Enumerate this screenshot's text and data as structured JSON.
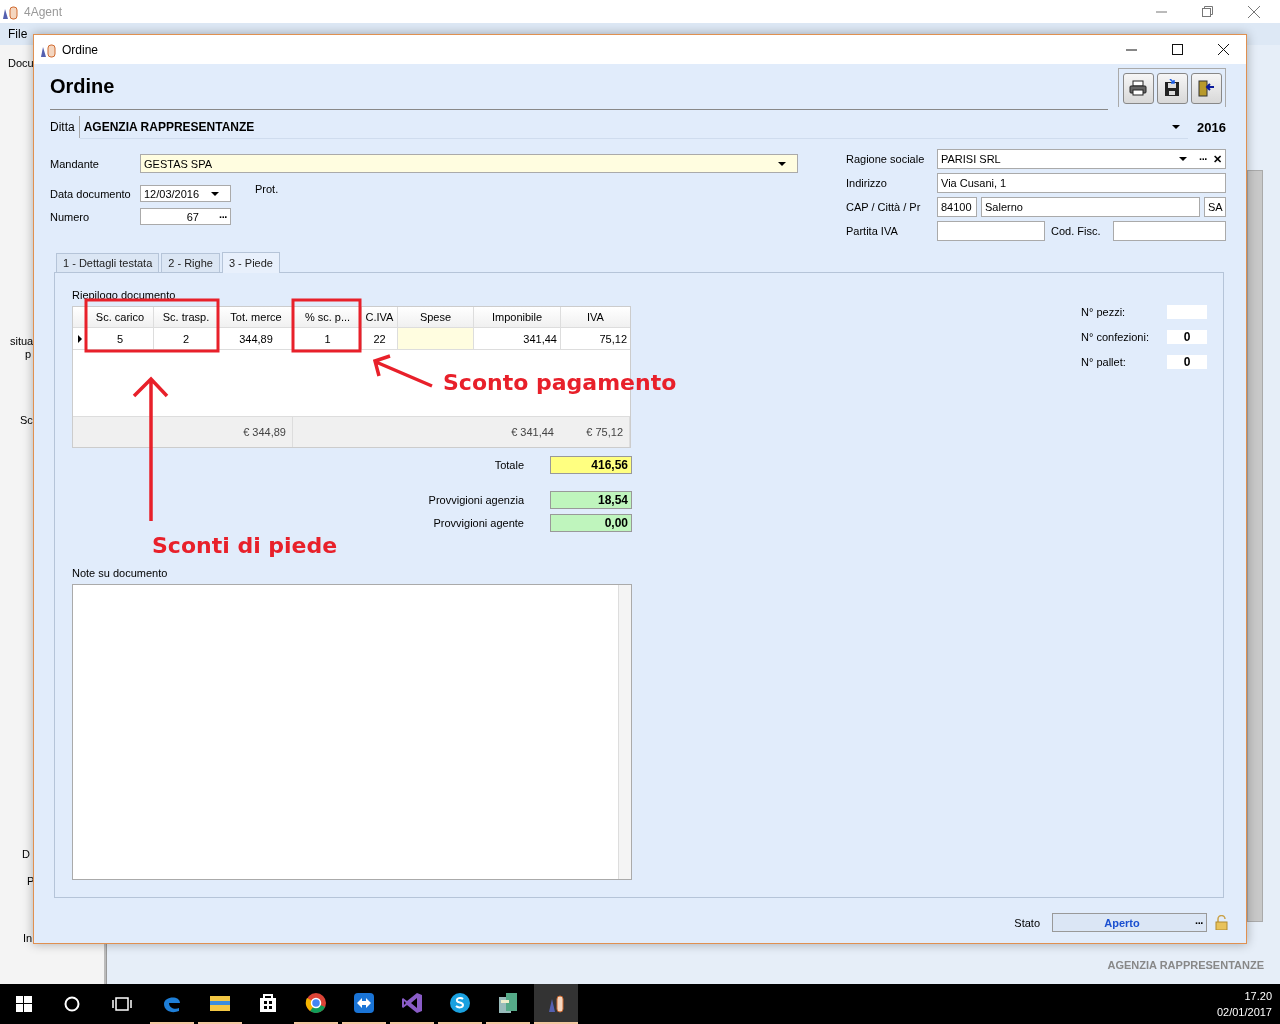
{
  "app": {
    "title": "4Agent",
    "menu": [
      "File"
    ],
    "side_fragments": [
      "Docu",
      "situa",
      "p",
      "Sc",
      "D",
      "P",
      "In"
    ],
    "footer": "AGENZIA RAPPRESENTANZE"
  },
  "dialog": {
    "title": "Ordine",
    "heading": "Ordine",
    "toolbar": [
      {
        "kind": "print"
      },
      {
        "kind": "save"
      },
      {
        "kind": "exit"
      }
    ],
    "ditta": {
      "label": "Ditta",
      "value": "AGENZIA RAPPRESENTANZE",
      "year": "2016"
    },
    "mandante": {
      "label": "Mandante",
      "value": "GESTAS SPA"
    },
    "data_documento": {
      "label": "Data documento",
      "value": "12/03/2016"
    },
    "numero": {
      "label": "Numero",
      "value": "67",
      "more": "···"
    },
    "prot": {
      "label": "Prot."
    },
    "ragione_sociale": {
      "label": "Ragione sociale",
      "value": "PARISI SRL",
      "more": "···",
      "clear": "✕"
    },
    "indirizzo": {
      "label": "Indirizzo",
      "value": "Via Cusani, 1"
    },
    "cap_citta_pr": {
      "label": "CAP / Città / Pr",
      "cap": "84100",
      "citta": "Salerno",
      "pr": "SA"
    },
    "partita_iva": {
      "label": "Partita IVA",
      "cod_fisc_label": "Cod. Fisc."
    },
    "tabs": [
      {
        "label": "1 - Dettagli testata",
        "selected": false
      },
      {
        "label": "2 - Righe",
        "selected": false
      },
      {
        "label": "3 - Piede",
        "selected": true
      }
    ],
    "riepilogo": {
      "title": "Riepilogo documento",
      "columns": [
        {
          "label": "Sc. carico",
          "highlighted": false
        },
        {
          "label": "Sc. trasp.",
          "highlighted": false
        },
        {
          "label": "Tot. merce",
          "highlighted": false,
          "total": "€ 344,89"
        },
        {
          "label": "% sc. p...",
          "highlighted": false
        },
        {
          "label": "C.IVA",
          "highlighted": false
        },
        {
          "label": "Spese",
          "highlighted": true
        },
        {
          "label": "Imponibile",
          "highlighted": false,
          "total": "€ 341,44"
        },
        {
          "label": "IVA",
          "highlighted": false,
          "total": "€ 75,12"
        }
      ],
      "row": {
        "current": true,
        "cells": [
          "5",
          "2",
          "344,89",
          "1",
          "22",
          null,
          "341,44",
          "75,12"
        ]
      }
    },
    "totals": [
      {
        "kind": "total",
        "label": "Totale",
        "value": "416,56"
      },
      {
        "kind": "commission",
        "label": "Provvigioni agenzia",
        "value": "18,54"
      },
      {
        "kind": "commission",
        "label": "Provvigioni agente",
        "value": "0,00"
      }
    ],
    "notes": {
      "label": "Note su documento"
    },
    "counts": [
      {
        "label": "N° pezzi:"
      },
      {
        "label": "N° confezioni:",
        "value": "0"
      },
      {
        "label": "N° pallet:",
        "value": "0"
      }
    ],
    "stato": {
      "label": "Stato",
      "value": "Aperto",
      "more": "···"
    }
  },
  "annotations": [
    {
      "text": "Sconto pagamento"
    },
    {
      "text": "Sconti di piede"
    }
  ],
  "taskbar": {
    "apps": [
      {
        "kind": "edge",
        "running": true,
        "selected": false
      },
      {
        "kind": "folder",
        "running": true,
        "selected": false
      },
      {
        "kind": "store",
        "running": false,
        "selected": false
      },
      {
        "kind": "chrome",
        "running": true,
        "selected": false
      },
      {
        "kind": "remote",
        "running": true,
        "selected": false
      },
      {
        "kind": "studio",
        "running": true,
        "selected": false
      },
      {
        "kind": "skype",
        "running": true,
        "selected": false
      },
      {
        "kind": "server",
        "running": true,
        "selected": false
      },
      {
        "kind": "agent",
        "running": true,
        "selected": true
      }
    ],
    "time": "17.20",
    "date": "02/01/2017"
  }
}
